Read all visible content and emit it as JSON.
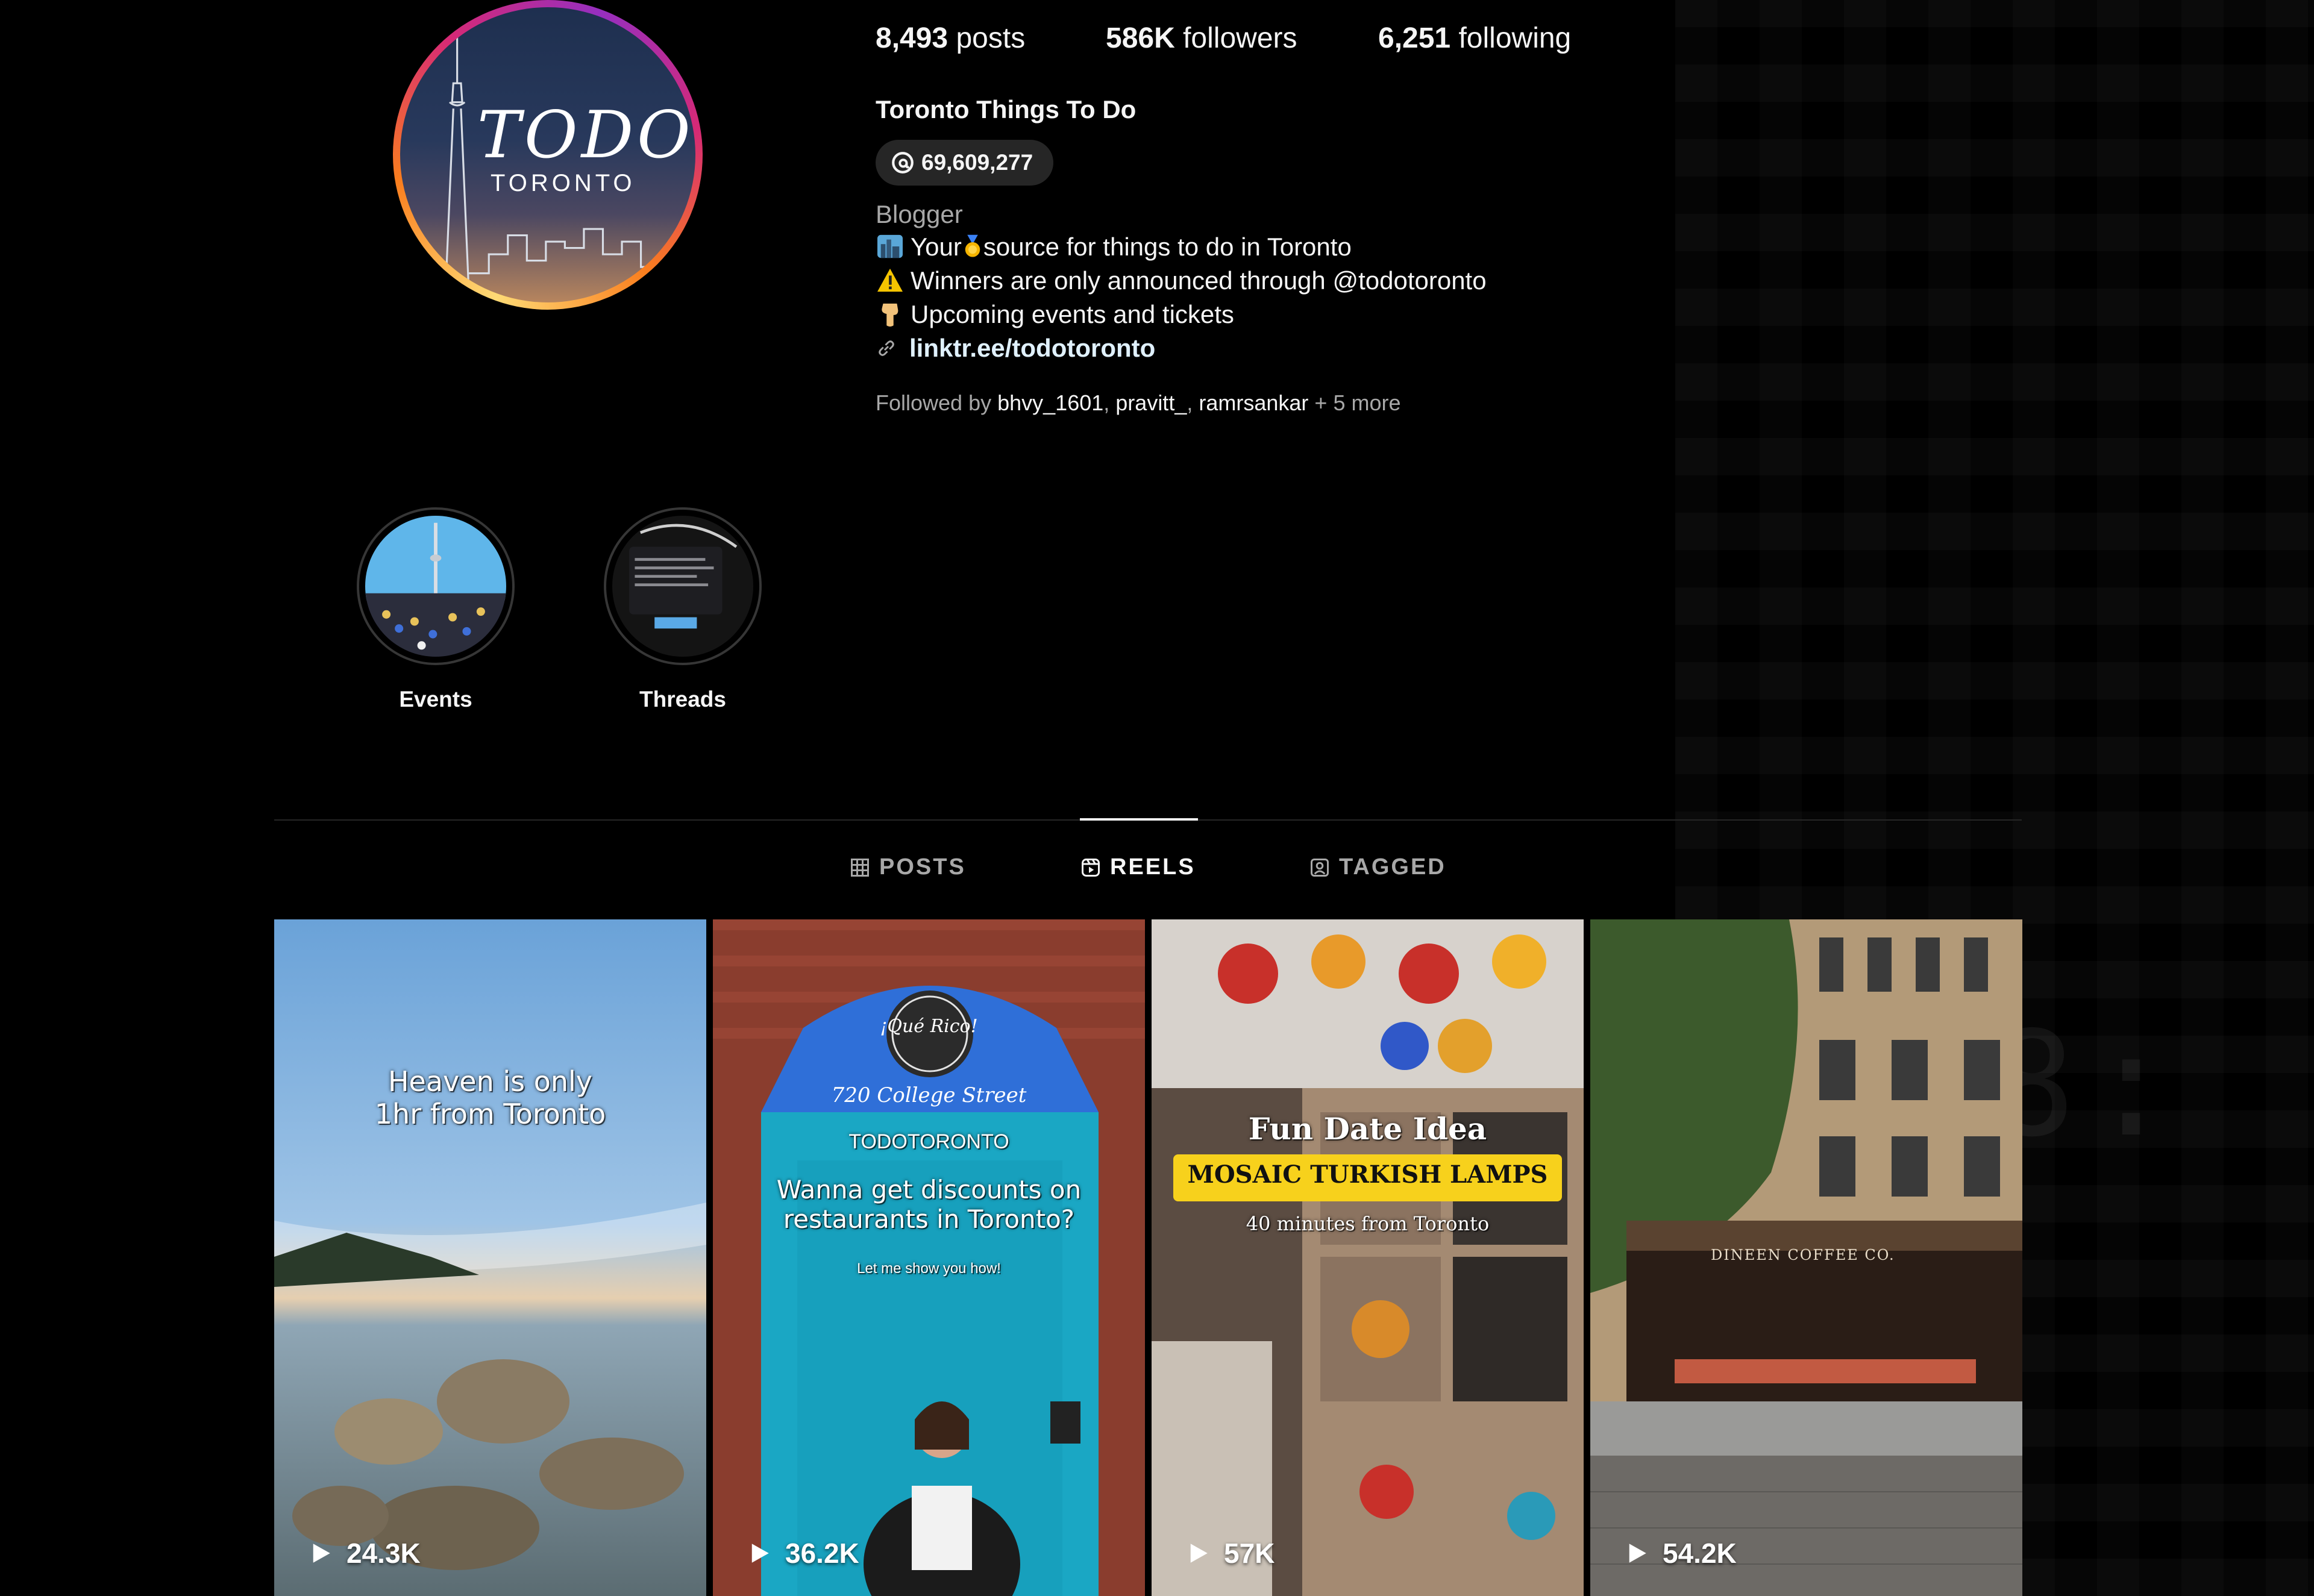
{
  "profile": {
    "avatar_title": "TODO",
    "avatar_sub": "TORONTO",
    "stats": [
      {
        "value": "8,493",
        "label": "posts"
      },
      {
        "value": "586K",
        "label": "followers"
      },
      {
        "value": "6,251",
        "label": "following"
      }
    ],
    "name": "Toronto Things To Do",
    "threads_count": "69,609,277",
    "category": "Blogger",
    "bio": {
      "line1_a": "Your",
      "line1_b": "source for things to do in Toronto",
      "line2": "Winners are only announced through @todotoronto",
      "line3": "Upcoming events and tickets"
    },
    "link": "linktr.ee/todotoronto",
    "followed_by": {
      "prefix": "Followed by",
      "users": [
        "bhvy_1601",
        "pravitt_",
        "ramrsankar"
      ],
      "more": "+ 5 more"
    }
  },
  "highlights": [
    {
      "label": "Events"
    },
    {
      "label": "Threads"
    }
  ],
  "tabs": [
    {
      "label": "POSTS",
      "active": false
    },
    {
      "label": "REELS",
      "active": true
    },
    {
      "label": "TAGGED",
      "active": false
    }
  ],
  "reels": [
    {
      "views": "24.3K",
      "caption": [
        "Heaven is only",
        "1hr from Toronto"
      ]
    },
    {
      "views": "36.2K",
      "sign": "¡Qué Rico!",
      "address": "720 College Street",
      "brand": "TODOTORONTO",
      "caption": [
        "Wanna get discounts on",
        "restaurants in Toronto?"
      ],
      "sub": "Let me show you how!"
    },
    {
      "views": "57K",
      "caption": [
        "Fun Date Idea",
        "MOSAIC TURKISH LAMPS",
        "40 minutes from Toronto"
      ]
    },
    {
      "views": "54.2K",
      "storefront": "DINEEN COFFEE CO."
    }
  ],
  "colors": {
    "background": "#000000",
    "text": "#f5f5f5",
    "muted": "#a8a8a8",
    "badge": "#262626",
    "link": "#e0f1ff"
  }
}
